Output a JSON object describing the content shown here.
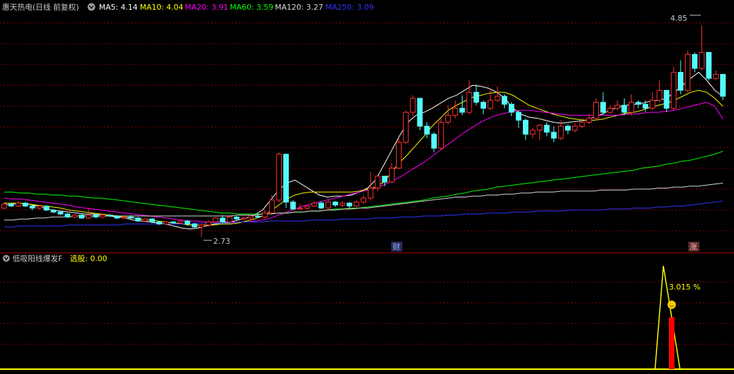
{
  "header": {
    "stock": "惠天热电",
    "mode": "(日线 前复权)",
    "ma": [
      {
        "label": "MA5: 4.14",
        "color": "#ffffff"
      },
      {
        "label": "MA10: 4.04",
        "color": "#ffff00"
      },
      {
        "label": "MA20: 3.91",
        "color": "#ff00ff"
      },
      {
        "label": "MA60: 3.59",
        "color": "#00ff00"
      },
      {
        "label": "MA120: 3.27",
        "color": "#d8d8d8"
      },
      {
        "label": "MA250: 3.09",
        "color": "#3333ff"
      }
    ]
  },
  "indicator": {
    "name": "低吸阳线爆发F",
    "value_label": "选股: 0.00",
    "peak_label": "3.015 %"
  },
  "annotations": {
    "high": "4.85",
    "low": "2.73",
    "cai": "财",
    "zhang": "涨"
  },
  "colors": {
    "up": "#ff3232",
    "down": "#54fcfc",
    "grid": "#8b0000",
    "ind": "#ffff00",
    "bar": "#ff0000"
  },
  "chart_data": {
    "type": "candlestick",
    "series": [
      {
        "name": "MA5",
        "color": "#ffffff",
        "values": [
          3.05,
          3.06,
          3.07,
          3.06,
          3.04,
          3.02,
          3.0,
          2.99,
          2.98,
          2.97,
          2.96,
          2.96,
          2.95,
          2.94,
          2.93,
          2.92,
          2.9,
          2.89,
          2.88,
          2.87,
          2.86,
          2.84,
          2.82,
          2.81,
          2.82,
          2.84,
          2.86,
          2.87,
          2.88,
          2.9,
          2.92,
          2.95,
          3.0,
          3.1,
          3.2,
          3.27,
          3.3,
          3.25,
          3.2,
          3.15,
          3.13,
          3.14,
          3.14,
          3.15,
          3.18,
          3.22,
          3.3,
          3.45,
          3.6,
          3.75,
          3.88,
          3.95,
          3.98,
          4.02,
          4.07,
          4.12,
          4.15,
          4.2,
          4.25,
          4.24,
          4.22,
          4.18,
          4.12,
          4.02,
          3.96,
          3.93,
          3.92,
          3.9,
          3.88,
          3.87,
          3.88,
          3.89,
          3.9,
          3.93,
          3.96,
          4.0,
          4.03,
          4.05,
          4.06,
          4.07,
          4.09,
          4.1,
          4.12,
          4.18,
          4.25,
          4.32,
          4.38,
          4.3,
          4.2,
          4.14
        ]
      },
      {
        "name": "MA10",
        "color": "#ffff00",
        "values": [
          3.07,
          3.07,
          3.07,
          3.06,
          3.05,
          3.04,
          3.03,
          3.02,
          3.0,
          2.99,
          2.98,
          2.97,
          2.96,
          2.95,
          2.94,
          2.93,
          2.92,
          2.91,
          2.9,
          2.89,
          2.88,
          2.87,
          2.86,
          2.85,
          2.85,
          2.85,
          2.85,
          2.86,
          2.86,
          2.87,
          2.89,
          2.91,
          2.94,
          2.99,
          3.05,
          3.11,
          3.15,
          3.17,
          3.18,
          3.18,
          3.18,
          3.18,
          3.18,
          3.18,
          3.19,
          3.21,
          3.23,
          3.28,
          3.38,
          3.48,
          3.56,
          3.65,
          3.74,
          3.84,
          3.92,
          4.0,
          4.05,
          4.09,
          4.13,
          4.15,
          4.17,
          4.18,
          4.18,
          4.15,
          4.1,
          4.05,
          4.02,
          3.99,
          3.96,
          3.94,
          3.92,
          3.91,
          3.9,
          3.9,
          3.91,
          3.93,
          3.95,
          3.97,
          3.98,
          4.0,
          4.03,
          4.05,
          4.07,
          4.1,
          4.14,
          4.18,
          4.2,
          4.18,
          4.12,
          4.04
        ]
      },
      {
        "name": "MA20",
        "color": "#ff00ff",
        "values": [
          3.12,
          3.11,
          3.11,
          3.1,
          3.09,
          3.08,
          3.07,
          3.06,
          3.05,
          3.03,
          3.02,
          3.01,
          3.0,
          2.99,
          2.98,
          2.97,
          2.96,
          2.95,
          2.94,
          2.93,
          2.92,
          2.91,
          2.9,
          2.89,
          2.89,
          2.88,
          2.88,
          2.88,
          2.88,
          2.88,
          2.88,
          2.89,
          2.9,
          2.92,
          2.95,
          2.98,
          3.01,
          3.04,
          3.06,
          3.08,
          3.1,
          3.12,
          3.14,
          3.16,
          3.18,
          3.2,
          3.22,
          3.25,
          3.29,
          3.33,
          3.38,
          3.43,
          3.48,
          3.54,
          3.6,
          3.66,
          3.72,
          3.78,
          3.83,
          3.88,
          3.92,
          3.95,
          3.97,
          3.99,
          4.0,
          4.0,
          3.99,
          3.98,
          3.97,
          3.96,
          3.95,
          3.95,
          3.95,
          3.95,
          3.95,
          3.95,
          3.95,
          3.96,
          3.96,
          3.97,
          3.98,
          3.98,
          3.99,
          4.0,
          4.02,
          4.04,
          4.06,
          4.08,
          4.04,
          3.91
        ]
      },
      {
        "name": "MA60",
        "color": "#00ff00",
        "values": [
          3.18,
          3.18,
          3.17,
          3.17,
          3.16,
          3.16,
          3.15,
          3.15,
          3.14,
          3.14,
          3.13,
          3.12,
          3.12,
          3.11,
          3.1,
          3.09,
          3.08,
          3.07,
          3.06,
          3.05,
          3.04,
          3.03,
          3.02,
          3.01,
          3.0,
          2.99,
          2.98,
          2.97,
          2.97,
          2.96,
          2.96,
          2.96,
          2.96,
          2.96,
          2.97,
          2.97,
          2.98,
          2.98,
          2.99,
          2.99,
          3.0,
          3.01,
          3.01,
          3.02,
          3.02,
          3.03,
          3.04,
          3.05,
          3.06,
          3.07,
          3.08,
          3.09,
          3.1,
          3.12,
          3.13,
          3.14,
          3.16,
          3.17,
          3.19,
          3.2,
          3.21,
          3.23,
          3.24,
          3.25,
          3.26,
          3.27,
          3.28,
          3.29,
          3.3,
          3.31,
          3.32,
          3.33,
          3.34,
          3.35,
          3.36,
          3.37,
          3.38,
          3.39,
          3.4,
          3.42,
          3.43,
          3.44,
          3.46,
          3.47,
          3.49,
          3.5,
          3.52,
          3.54,
          3.56,
          3.59
        ]
      },
      {
        "name": "MA120",
        "color": "#d8d8d8",
        "values": [
          2.9,
          2.9,
          2.91,
          2.91,
          2.92,
          2.92,
          2.93,
          2.93,
          2.93,
          2.94,
          2.94,
          2.94,
          2.94,
          2.94,
          2.94,
          2.94,
          2.94,
          2.94,
          2.94,
          2.94,
          2.94,
          2.94,
          2.94,
          2.94,
          2.94,
          2.94,
          2.94,
          2.94,
          2.94,
          2.95,
          2.95,
          2.95,
          2.96,
          2.96,
          2.97,
          2.97,
          2.98,
          2.98,
          2.99,
          2.99,
          3.0,
          3.0,
          3.01,
          3.01,
          3.02,
          3.02,
          3.03,
          3.04,
          3.05,
          3.06,
          3.07,
          3.08,
          3.09,
          3.1,
          3.11,
          3.12,
          3.13,
          3.13,
          3.14,
          3.14,
          3.15,
          3.15,
          3.16,
          3.16,
          3.17,
          3.17,
          3.18,
          3.18,
          3.18,
          3.19,
          3.19,
          3.19,
          3.19,
          3.19,
          3.2,
          3.2,
          3.2,
          3.2,
          3.21,
          3.21,
          3.21,
          3.22,
          3.22,
          3.23,
          3.23,
          3.24,
          3.24,
          3.25,
          3.26,
          3.27
        ]
      },
      {
        "name": "MA250",
        "color": "#3333ff",
        "values": [
          2.83,
          2.83,
          2.84,
          2.84,
          2.84,
          2.84,
          2.84,
          2.84,
          2.85,
          2.85,
          2.85,
          2.85,
          2.85,
          2.85,
          2.85,
          2.86,
          2.86,
          2.86,
          2.86,
          2.86,
          2.86,
          2.86,
          2.86,
          2.86,
          2.87,
          2.87,
          2.87,
          2.87,
          2.87,
          2.88,
          2.88,
          2.88,
          2.88,
          2.89,
          2.89,
          2.89,
          2.89,
          2.89,
          2.9,
          2.9,
          2.9,
          2.9,
          2.91,
          2.91,
          2.91,
          2.91,
          2.92,
          2.92,
          2.92,
          2.93,
          2.93,
          2.93,
          2.94,
          2.94,
          2.94,
          2.95,
          2.95,
          2.96,
          2.96,
          2.96,
          2.97,
          2.97,
          2.97,
          2.98,
          2.98,
          2.98,
          2.99,
          2.99,
          2.99,
          2.99,
          3.0,
          3.0,
          3.0,
          3.0,
          3.0,
          3.01,
          3.01,
          3.01,
          3.02,
          3.02,
          3.02,
          3.03,
          3.03,
          3.04,
          3.04,
          3.05,
          3.06,
          3.07,
          3.08,
          3.09
        ]
      }
    ],
    "candles": [
      [
        3.02,
        3.06,
        3.08,
        3.01
      ],
      [
        3.06,
        3.04,
        3.07,
        3.03
      ],
      [
        3.04,
        3.07,
        3.09,
        3.03
      ],
      [
        3.07,
        3.04,
        3.08,
        3.03
      ],
      [
        3.04,
        3.02,
        3.05,
        3.0
      ],
      [
        3.02,
        3.04,
        3.05,
        3.01
      ],
      [
        3.04,
        3.0,
        3.05,
        2.99
      ],
      [
        3.0,
        2.98,
        3.01,
        2.97
      ],
      [
        2.98,
        2.96,
        2.99,
        2.95
      ],
      [
        2.96,
        2.93,
        2.97,
        2.92
      ],
      [
        2.93,
        2.95,
        2.96,
        2.92
      ],
      [
        2.95,
        2.92,
        2.96,
        2.91
      ],
      [
        2.92,
        2.95,
        3.02,
        2.91
      ],
      [
        2.95,
        2.93,
        2.96,
        2.92
      ],
      [
        2.93,
        2.95,
        2.96,
        2.92
      ],
      [
        2.95,
        2.94,
        2.96,
        2.93
      ],
      [
        2.94,
        2.92,
        2.95,
        2.91
      ],
      [
        2.92,
        2.93,
        2.94,
        2.91
      ],
      [
        2.93,
        2.92,
        2.95,
        2.91
      ],
      [
        2.92,
        2.89,
        2.93,
        2.88
      ],
      [
        2.89,
        2.91,
        2.92,
        2.88
      ],
      [
        2.91,
        2.88,
        2.92,
        2.87
      ],
      [
        2.88,
        2.86,
        2.89,
        2.85
      ],
      [
        2.86,
        2.88,
        2.89,
        2.85
      ],
      [
        2.88,
        2.87,
        2.89,
        2.86
      ],
      [
        2.87,
        2.89,
        2.9,
        2.86
      ],
      [
        2.89,
        2.86,
        2.9,
        2.84
      ],
      [
        2.86,
        2.83,
        2.87,
        2.82
      ],
      [
        2.83,
        2.85,
        2.86,
        2.73
      ],
      [
        2.85,
        2.88,
        2.9,
        2.83
      ],
      [
        2.88,
        2.92,
        2.93,
        2.86
      ],
      [
        2.92,
        2.88,
        2.95,
        2.87
      ],
      [
        2.88,
        2.93,
        2.95,
        2.87
      ],
      [
        2.93,
        2.91,
        2.94,
        2.9
      ],
      [
        2.91,
        2.92,
        2.93,
        2.9
      ],
      [
        2.92,
        2.94,
        2.95,
        2.9
      ],
      [
        2.94,
        2.93,
        2.95,
        2.92
      ],
      [
        2.93,
        2.97,
        3.0,
        2.92
      ],
      [
        2.97,
        3.1,
        3.15,
        2.96
      ],
      [
        3.1,
        3.56,
        3.58,
        3.08
      ],
      [
        3.56,
        3.08,
        3.56,
        3.02
      ],
      [
        3.08,
        3.01,
        3.1,
        3.0
      ],
      [
        3.01,
        3.02,
        3.06,
        3.0
      ],
      [
        3.02,
        3.04,
        3.05,
        3.0
      ],
      [
        3.04,
        3.07,
        3.09,
        3.03
      ],
      [
        3.07,
        3.02,
        3.09,
        3.01
      ],
      [
        3.02,
        3.08,
        3.1,
        3.0
      ],
      [
        3.08,
        3.05,
        3.09,
        3.03
      ],
      [
        3.05,
        3.07,
        3.09,
        3.03
      ],
      [
        3.07,
        3.04,
        3.08,
        3.02
      ],
      [
        3.04,
        3.08,
        3.1,
        3.03
      ],
      [
        3.08,
        3.12,
        3.15,
        3.06
      ],
      [
        3.12,
        3.22,
        3.38,
        3.1
      ],
      [
        3.22,
        3.34,
        3.36,
        3.19
      ],
      [
        3.34,
        3.28,
        3.34,
        3.24
      ],
      [
        3.28,
        3.42,
        3.47,
        3.27
      ],
      [
        3.42,
        3.68,
        3.72,
        3.41
      ],
      [
        3.68,
        3.98,
        4.0,
        3.66
      ],
      [
        3.98,
        4.12,
        4.15,
        3.94
      ],
      [
        4.12,
        3.84,
        4.12,
        3.8
      ],
      [
        3.84,
        3.76,
        3.88,
        3.72
      ],
      [
        3.76,
        3.62,
        3.78,
        3.58
      ],
      [
        3.62,
        3.88,
        3.92,
        3.6
      ],
      [
        3.88,
        3.95,
        4.05,
        3.86
      ],
      [
        3.95,
        4.02,
        4.1,
        3.92
      ],
      [
        4.02,
        3.98,
        4.15,
        3.95
      ],
      [
        3.98,
        4.18,
        4.3,
        3.96
      ],
      [
        4.18,
        4.08,
        4.26,
        4.05
      ],
      [
        4.08,
        4.02,
        4.1,
        3.96
      ],
      [
        4.02,
        4.1,
        4.22,
        4.0
      ],
      [
        4.1,
        4.14,
        4.24,
        4.08
      ],
      [
        4.14,
        4.06,
        4.16,
        4.02
      ],
      [
        4.06,
        3.98,
        4.08,
        3.94
      ],
      [
        3.98,
        3.9,
        4.0,
        3.82
      ],
      [
        3.9,
        3.76,
        3.92,
        3.7
      ],
      [
        3.76,
        3.8,
        3.82,
        3.72
      ],
      [
        3.8,
        3.85,
        3.86,
        3.7
      ],
      [
        3.85,
        3.78,
        3.88,
        3.74
      ],
      [
        3.78,
        3.72,
        3.84,
        3.68
      ],
      [
        3.72,
        3.84,
        3.9,
        3.7
      ],
      [
        3.84,
        3.8,
        3.86,
        3.76
      ],
      [
        3.8,
        3.84,
        3.87,
        3.78
      ],
      [
        3.84,
        3.88,
        3.92,
        3.82
      ],
      [
        3.88,
        3.92,
        3.96,
        3.86
      ],
      [
        3.92,
        4.08,
        4.12,
        3.9
      ],
      [
        4.08,
        3.98,
        4.18,
        3.95
      ],
      [
        3.98,
        4.02,
        4.05,
        3.96
      ],
      [
        4.02,
        4.05,
        4.1,
        4.0
      ],
      [
        4.05,
        3.98,
        4.12,
        3.95
      ],
      [
        3.98,
        4.08,
        4.16,
        3.95
      ],
      [
        4.08,
        4.06,
        4.1,
        4.02
      ],
      [
        4.06,
        4.02,
        4.1,
        3.98
      ],
      [
        4.02,
        4.1,
        4.18,
        4.0
      ],
      [
        4.1,
        4.2,
        4.3,
        4.08
      ],
      [
        4.2,
        4.02,
        4.2,
        3.98
      ],
      [
        4.02,
        4.38,
        4.44,
        4.0
      ],
      [
        4.38,
        4.2,
        4.5,
        4.16
      ],
      [
        4.2,
        4.56,
        4.6,
        4.18
      ],
      [
        4.56,
        4.42,
        4.58,
        4.38
      ],
      [
        4.42,
        4.58,
        4.85,
        4.4
      ],
      [
        4.58,
        4.32,
        4.45,
        4.3
      ],
      [
        4.32,
        4.36,
        4.4,
        4.3
      ],
      [
        4.36,
        4.14,
        4.2,
        4.1
      ]
    ],
    "candle_offset": 0,
    "xlabel": "",
    "ylabel": ""
  }
}
